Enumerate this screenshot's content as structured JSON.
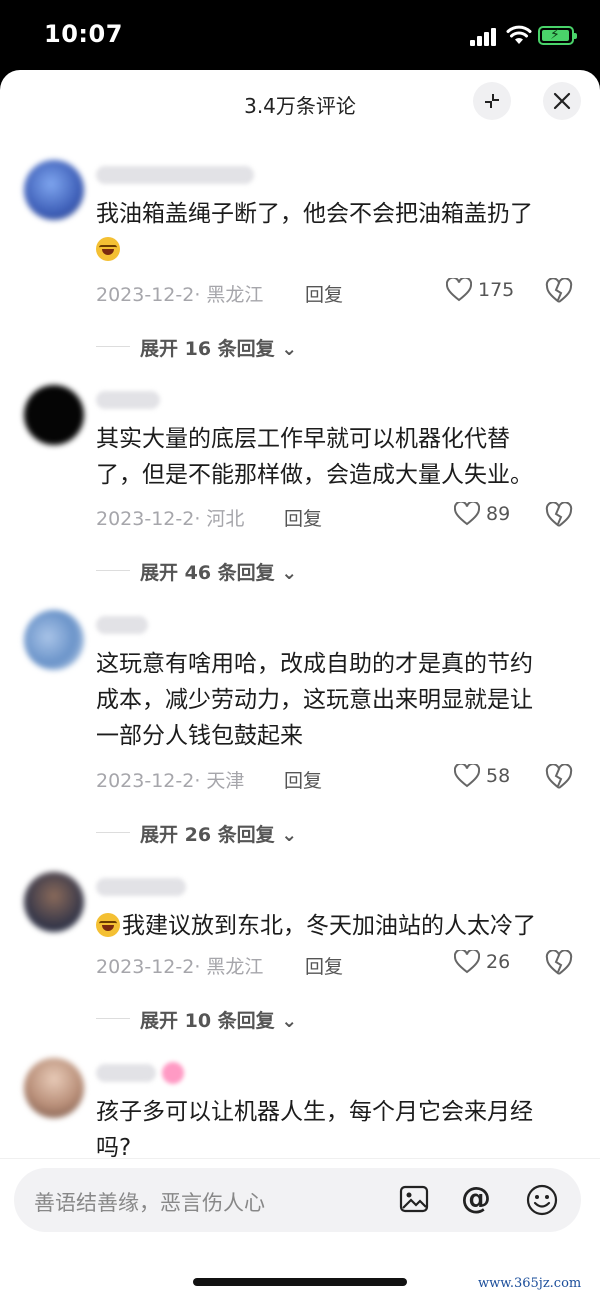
{
  "status_bar": {
    "time": "10:07"
  },
  "header": {
    "title": "3.4万条评论"
  },
  "comments": [
    {
      "text_line1": "我油箱盖绳子断了，他会不会把油箱盖扔了",
      "meta": "2023-12-2· 黑龙江",
      "reply": "回复",
      "likes": "175",
      "expand": "展开 16 条回复"
    },
    {
      "text_line1": "其实大量的底层工作早就可以机器化代替",
      "text_line2": "了，但是不能那样做，会造成大量人失业。",
      "meta": "2023-12-2· 河北",
      "reply": "回复",
      "likes": "89",
      "expand": "展开 46 条回复"
    },
    {
      "text_line1": "这玩意有啥用哈，改成自助的才是真的节约",
      "text_line2": "成本，减少劳动力，这玩意出来明显就是让",
      "text_line3": "一部分人钱包鼓起来",
      "meta": "2023-12-2· 天津",
      "reply": "回复",
      "likes": "58",
      "expand": "展开 26 条回复"
    },
    {
      "text_line1": "我建议放到东北，冬天加油站的人太冷了",
      "meta": "2023-12-2· 黑龙江",
      "reply": "回复",
      "likes": "26",
      "expand": "展开 10 条回复"
    },
    {
      "text_line1": "孩子多可以让机器人生，每个月它会来月经",
      "text_line2": "吗?"
    }
  ],
  "input": {
    "placeholder": "善语结善缘，恶言伤人心"
  },
  "watermark": "www.365jz.com",
  "colors": {
    "accent_battery": "#4ad36a",
    "text_meta": "#a6a6ab"
  }
}
